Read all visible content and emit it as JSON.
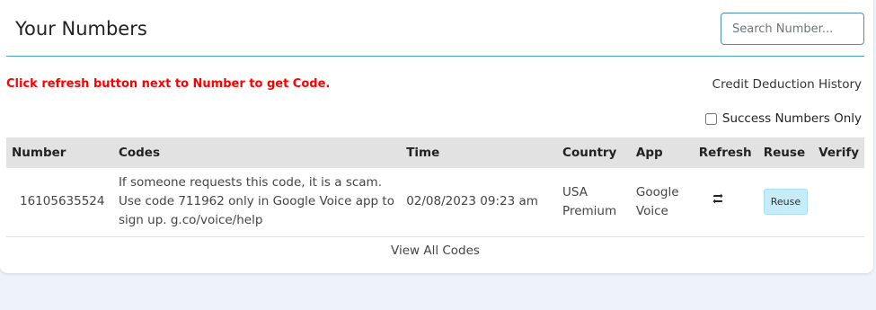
{
  "header": {
    "title": "Your Numbers"
  },
  "search": {
    "placeholder": "Search Number..."
  },
  "notice": "Click refresh button next to Number to get Code.",
  "credit_link": "Credit Deduction History",
  "success_filter": {
    "label": "Success Numbers Only",
    "checked": false
  },
  "table": {
    "columns": [
      "Number",
      "Codes",
      "Time",
      "Country",
      "App",
      "Refresh",
      "Reuse",
      "Verify"
    ],
    "rows": [
      {
        "number": "16105635524",
        "code_lines": [
          "If someone requests this code, it is a scam.",
          "Use code 711962 only in Google Voice app to",
          "sign up. g.co/voice/help"
        ],
        "time": "02/08/2023 09:23 am",
        "country_lines": [
          "USA",
          "Premium"
        ],
        "app_lines": [
          "Google",
          "Voice"
        ],
        "refresh_icon": "refresh-icon",
        "reuse_label": "Reuse",
        "verify": ""
      }
    ],
    "view_all": "View All Codes"
  },
  "colors": {
    "notice": "#ff0000",
    "reuse_bg": "#c5ecf8",
    "header_rule": "#4a9fc8",
    "search_border": "#4a8fbf"
  }
}
